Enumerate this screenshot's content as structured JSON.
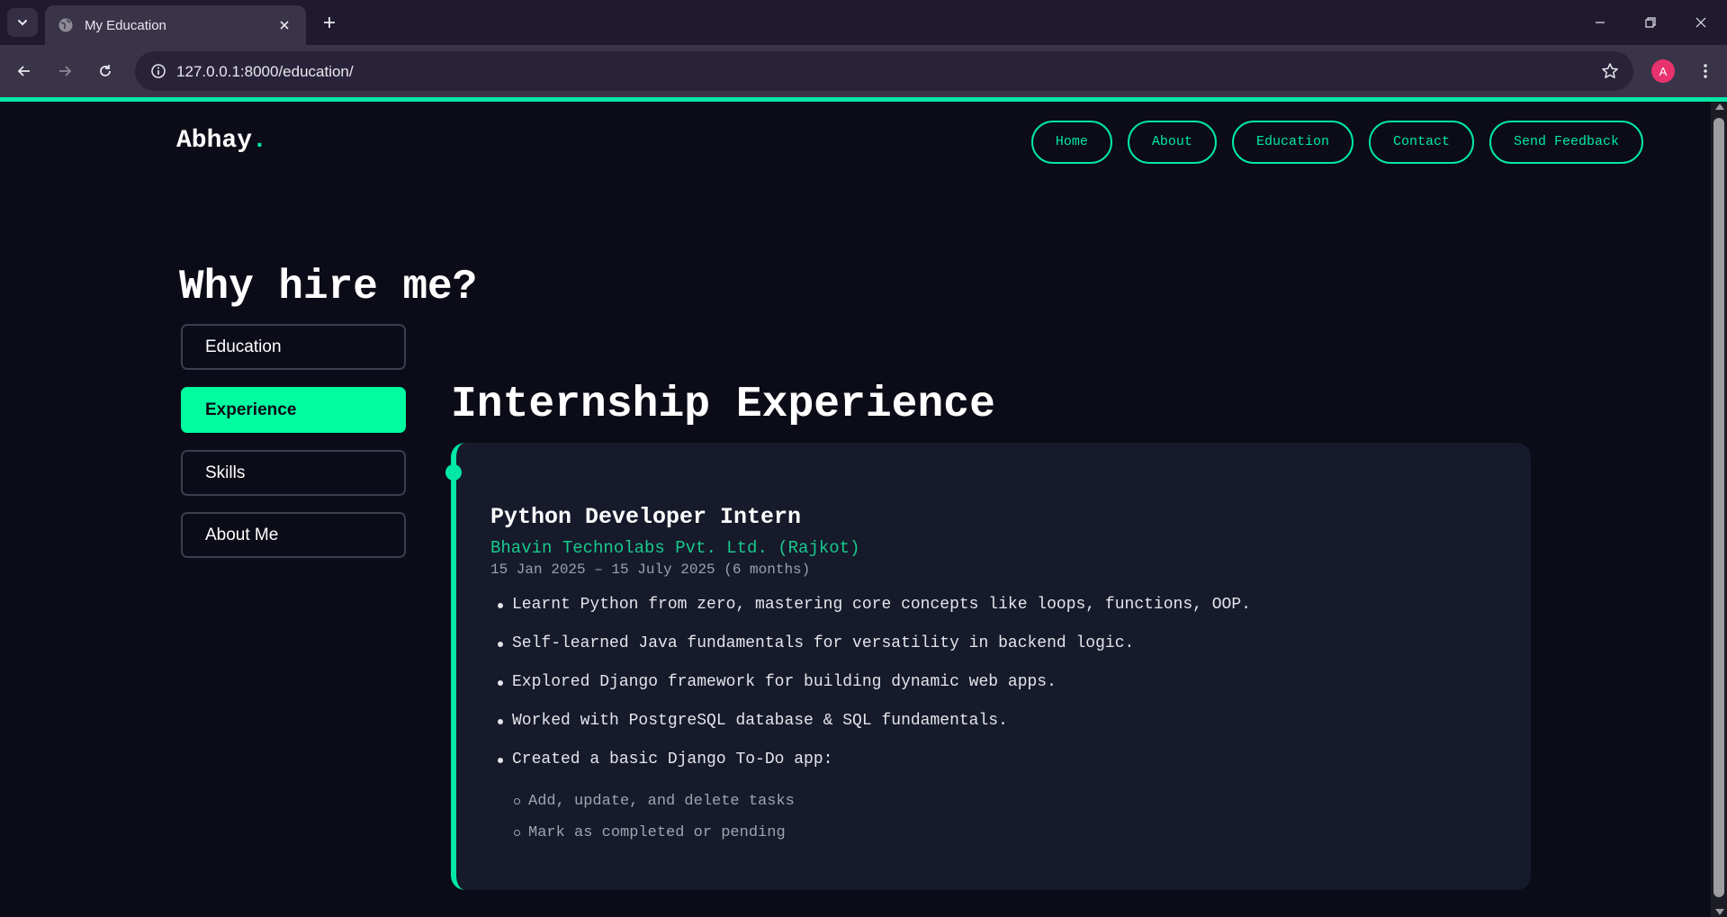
{
  "browser": {
    "tab_title": "My Education",
    "url": "127.0.0.1:8000/education/",
    "profile_initial": "A"
  },
  "site": {
    "logo_text": "Abhay",
    "logo_dot": ".",
    "nav": [
      "Home",
      "About",
      "Education",
      "Contact",
      "Send Feedback"
    ]
  },
  "hero_title": "Why hire me?",
  "side_tabs": [
    {
      "label": "Education",
      "active": false
    },
    {
      "label": "Experience",
      "active": true
    },
    {
      "label": "Skills",
      "active": false
    },
    {
      "label": "About Me",
      "active": false
    }
  ],
  "section": {
    "title": "Internship Experience",
    "job_title": "Python Developer Intern",
    "company": "Bhavin Technolabs Pvt. Ltd. (Rajkot)",
    "duration": "15 Jan 2025 – 15 July 2025 (6 months)",
    "bullets": [
      "Learnt Python from zero, mastering core concepts like loops, functions, OOP.",
      "Self-learned Java fundamentals for versatility in backend logic.",
      "Explored Django framework for building dynamic web apps.",
      "Worked with PostgreSQL database & SQL fundamentals.",
      "Created a basic Django To-Do app:"
    ],
    "sub_bullets": [
      "Add, update, and delete tasks",
      "Mark as completed or pending"
    ]
  },
  "colors": {
    "accent": "#00e7a6",
    "active_tab": "#00fba0",
    "background": "#0b0c17",
    "card": "#161a2b"
  }
}
